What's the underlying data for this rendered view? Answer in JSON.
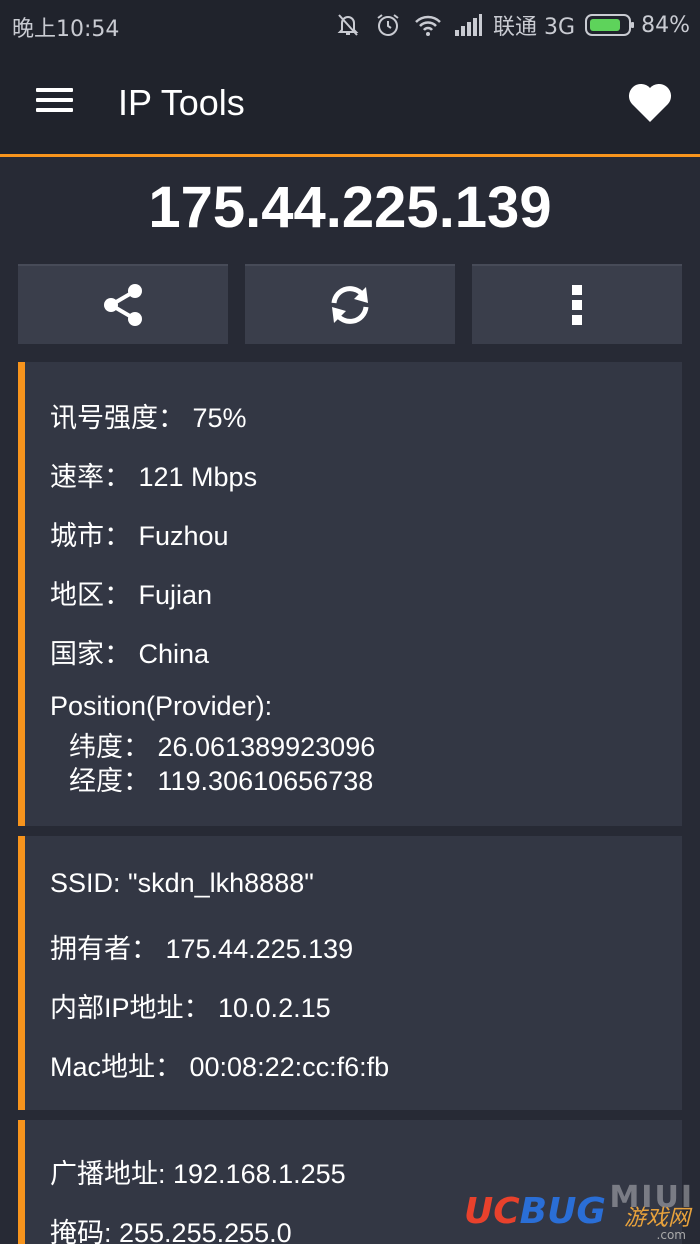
{
  "status_bar": {
    "time": "晚上10:54",
    "carrier": "联通 3G",
    "battery_percent": "84%",
    "battery_level": 0.84
  },
  "toolbar": {
    "title": "IP Tools",
    "menu_icon": "hamburger-menu-icon",
    "favorite_icon": "heart-icon"
  },
  "ip_address": "175.44.225.139",
  "actions": [
    {
      "icon": "share-icon"
    },
    {
      "icon": "refresh-icon"
    },
    {
      "icon": "more-vertical-icon"
    }
  ],
  "card1": {
    "signal": "讯号强度： 75%",
    "speed": "速率： 121 Mbps",
    "city": "城市： Fuzhou",
    "region": "地区： Fujian",
    "country": "国家： China",
    "position_label": "Position(Provider):",
    "latitude": "纬度： 26.061389923096",
    "longitude": "经度： 119.30610656738"
  },
  "card2": {
    "ssid": "SSID: \"skdn_lkh8888\"",
    "owner": "拥有者： 175.44.225.139",
    "internal_ip": "内部IP地址： 10.0.2.15",
    "mac": "Mac地址： 00:08:22:cc:f6:fb"
  },
  "card3": {
    "broadcast": "广播地址: 192.168.1.255",
    "mask": "掩码: 255.255.255.0"
  },
  "watermark": {
    "uc": "UC",
    "bug": "BUG",
    "miui": "MIUI",
    "cn": "游戏网",
    "com": ".com"
  },
  "colors": {
    "accent": "#f7941d",
    "background": "#272a35",
    "card": "#333744",
    "button": "#3a3e4b"
  }
}
